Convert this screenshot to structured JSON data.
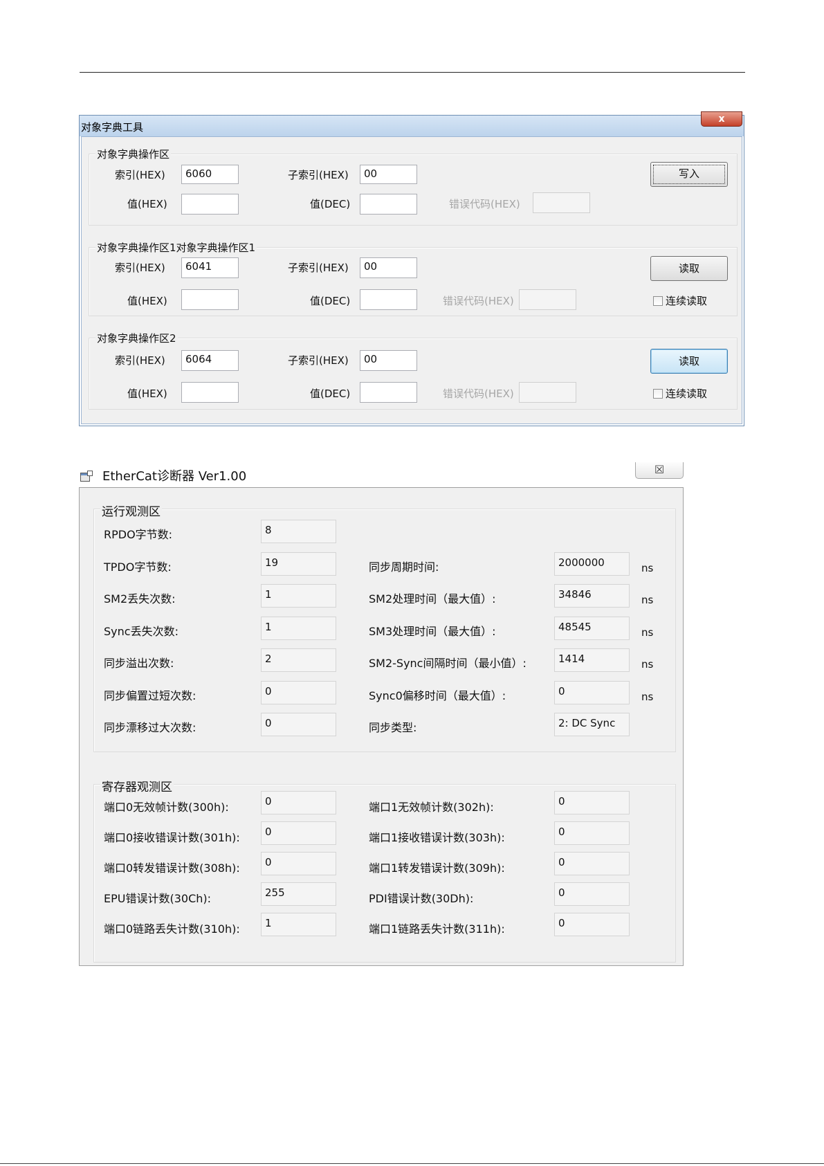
{
  "window1": {
    "title": "对象字典工具",
    "close_label": "x",
    "groups": [
      {
        "title": "对象字典操作区",
        "index_label": "索引(HEX)",
        "index_value": "6060",
        "subindex_label": "子索引(HEX)",
        "subindex_value": "00",
        "hex_label": "值(HEX)",
        "hex_value": "",
        "dec_label": "值(DEC)",
        "dec_value": "",
        "error_label": "错误代码(HEX)",
        "error_value": "",
        "button_label": "写入"
      },
      {
        "title": "对象字典操作区1对象字典操作区1",
        "index_label": "索引(HEX)",
        "index_value": "6041",
        "subindex_label": "子索引(HEX)",
        "subindex_value": "00",
        "hex_label": "值(HEX)",
        "hex_value": "",
        "dec_label": "值(DEC)",
        "dec_value": "",
        "error_label": "错误代码(HEX)",
        "error_value": "",
        "button_label": "读取",
        "checkbox_label": "连续读取",
        "checkbox_checked": false
      },
      {
        "title": "对象字典操作区2",
        "index_label": "索引(HEX)",
        "index_value": "6064",
        "subindex_label": "子索引(HEX)",
        "subindex_value": "00",
        "hex_label": "值(HEX)",
        "hex_value": "",
        "dec_label": "值(DEC)",
        "dec_value": "",
        "error_label": "错误代码(HEX)",
        "error_value": "",
        "button_label": "读取",
        "checkbox_label": "连续读取",
        "checkbox_checked": false
      }
    ]
  },
  "window2": {
    "title": "EtherCat诊断器 Ver1.00",
    "close_label": "☒",
    "runtime": {
      "title": "运行观测区",
      "left": [
        {
          "label": "RPDO字节数:",
          "value": "8"
        },
        {
          "label": "TPDO字节数:",
          "value": "19"
        },
        {
          "label": "SM2丢失次数:",
          "value": "1"
        },
        {
          "label": "Sync丢失次数:",
          "value": "1"
        },
        {
          "label": "同步溢出次数:",
          "value": "2"
        },
        {
          "label": "同步偏置过短次数:",
          "value": "0"
        },
        {
          "label": "同步漂移过大次数:",
          "value": "0"
        }
      ],
      "right": [
        {
          "label": "同步周期时间:",
          "value": "2000000",
          "unit": "ns"
        },
        {
          "label": "SM2处理时间（最大值）:",
          "value": "34846",
          "unit": "ns"
        },
        {
          "label": "SM3处理时间（最大值）:",
          "value": "48545",
          "unit": "ns"
        },
        {
          "label": "SM2-Sync间隔时间（最小值）:",
          "value": "1414",
          "unit": "ns"
        },
        {
          "label": "Sync0偏移时间（最大值）:",
          "value": "0",
          "unit": "ns"
        },
        {
          "label": "同步类型:",
          "value": "2: DC Sync",
          "unit": ""
        }
      ]
    },
    "registers": {
      "title": "寄存器观测区",
      "left": [
        {
          "label": "端口0无效帧计数(300h):",
          "value": "0"
        },
        {
          "label": "端口0接收错误计数(301h):",
          "value": "0"
        },
        {
          "label": "端口0转发错误计数(308h):",
          "value": "0"
        },
        {
          "label": "EPU错误计数(30Ch):",
          "value": "255"
        },
        {
          "label": "端口0链路丢失计数(310h):",
          "value": "1"
        }
      ],
      "right": [
        {
          "label": "端口1无效帧计数(302h):",
          "value": "0"
        },
        {
          "label": "端口1接收错误计数(303h):",
          "value": "0"
        },
        {
          "label": "端口1转发错误计数(309h):",
          "value": "0"
        },
        {
          "label": "PDI错误计数(30Dh):",
          "value": "0"
        },
        {
          "label": "端口1链路丢失计数(311h):",
          "value": "0"
        }
      ]
    }
  }
}
